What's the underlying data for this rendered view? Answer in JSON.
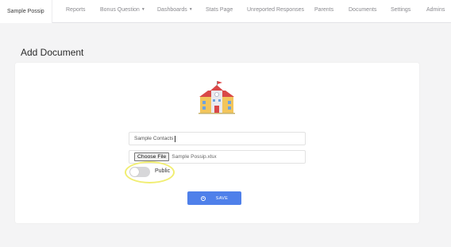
{
  "nav": {
    "brand": "Sample Possip",
    "items": [
      {
        "label": "Reports"
      },
      {
        "label": "Bonus Question",
        "dropdown": true
      },
      {
        "label": "Dashboards",
        "dropdown": true
      },
      {
        "label": "Stats Page"
      },
      {
        "label": "Unreported Responses"
      },
      {
        "label": "Parents"
      },
      {
        "label": "Documents"
      },
      {
        "label": "Settings"
      },
      {
        "label": "Admins"
      }
    ]
  },
  "page": {
    "title": "Add Document"
  },
  "form": {
    "name_value": "Sample Contacts",
    "file_button_label": "Choose File",
    "file_name": "Sample Possip.xlsx",
    "public_label": "Public",
    "public_enabled": false,
    "save_label": "SAVE"
  },
  "icons": {
    "school": "school-building-icon",
    "save": "save-circle-icon",
    "caret": "chevron-down-icon"
  },
  "colors": {
    "accent": "#4f80ea",
    "highlight": "#f1ee72",
    "toggle_off": "#d7d7d9"
  }
}
